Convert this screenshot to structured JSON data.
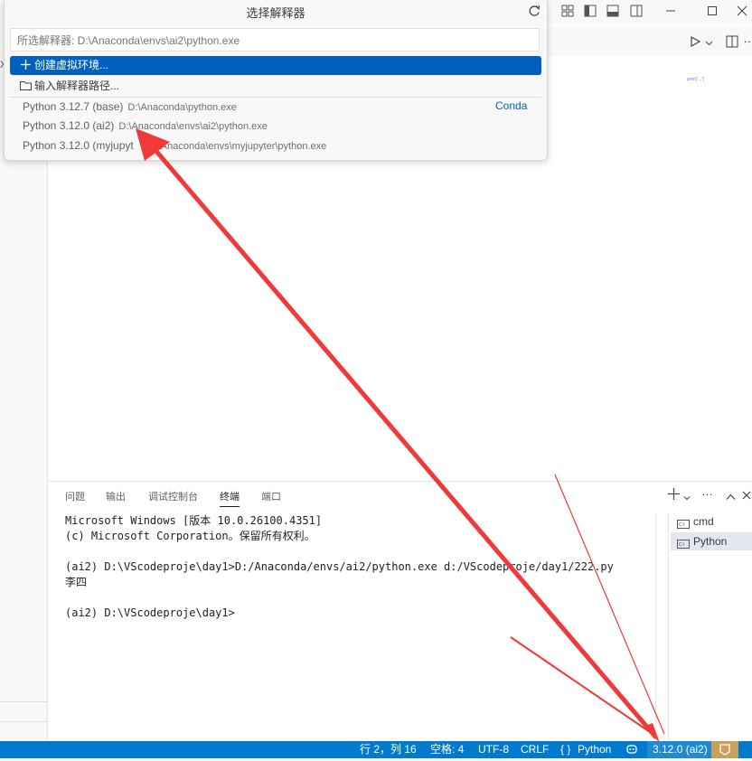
{
  "quick_pick": {
    "title": "选择解释器",
    "current_value": "所选解释器: D:\\Anaconda\\envs\\ai2\\python.exe",
    "actions": [
      {
        "label": "创建虚拟环境...",
        "icon": "plus-icon"
      },
      {
        "label": "输入解释器路径...",
        "icon": "folder-icon"
      }
    ],
    "interpreters": [
      {
        "name": "Python 3.12.7 (base)",
        "path": "D:\\Anaconda\\python.exe"
      },
      {
        "name": "Python 3.12.0 (ai2)",
        "path": "D:\\Anaconda\\envs\\ai2\\python.exe"
      },
      {
        "name": "Python 3.12.0 (myjupyt",
        "path": "D:\\Anaconda\\envs\\myjupyter\\python.exe"
      }
    ],
    "group_label": "Conda"
  },
  "panel": {
    "tabs": [
      "问题",
      "输出",
      "调试控制台",
      "终端",
      "端口"
    ],
    "active_tab": "终端",
    "terminal_lines": [
      "Microsoft Windows [版本 10.0.26100.4351]",
      "(c) Microsoft Corporation。保留所有权利。",
      "",
      "(ai2) D:\\VScodeproje\\day1>D:/Anaconda/envs/ai2/python.exe d:/VScodeproje/day1/222.py",
      "李四",
      "",
      "(ai2) D:\\VScodeproje\\day1>"
    ],
    "terminals": [
      "cmd",
      "Python"
    ]
  },
  "editor": {
    "left_glyph": "X",
    "tiny_text": "print('...')"
  },
  "status_bar": {
    "position": "行 2，列 16",
    "spaces": "空格: 4",
    "encoding": "UTF-8",
    "eol": "CRLF",
    "language_braces": "{ }",
    "language": "Python",
    "interpreter": "3.12.0 (ai2)",
    "colors": {
      "background": "#007acc",
      "annotation": "#f03a3a"
    }
  }
}
